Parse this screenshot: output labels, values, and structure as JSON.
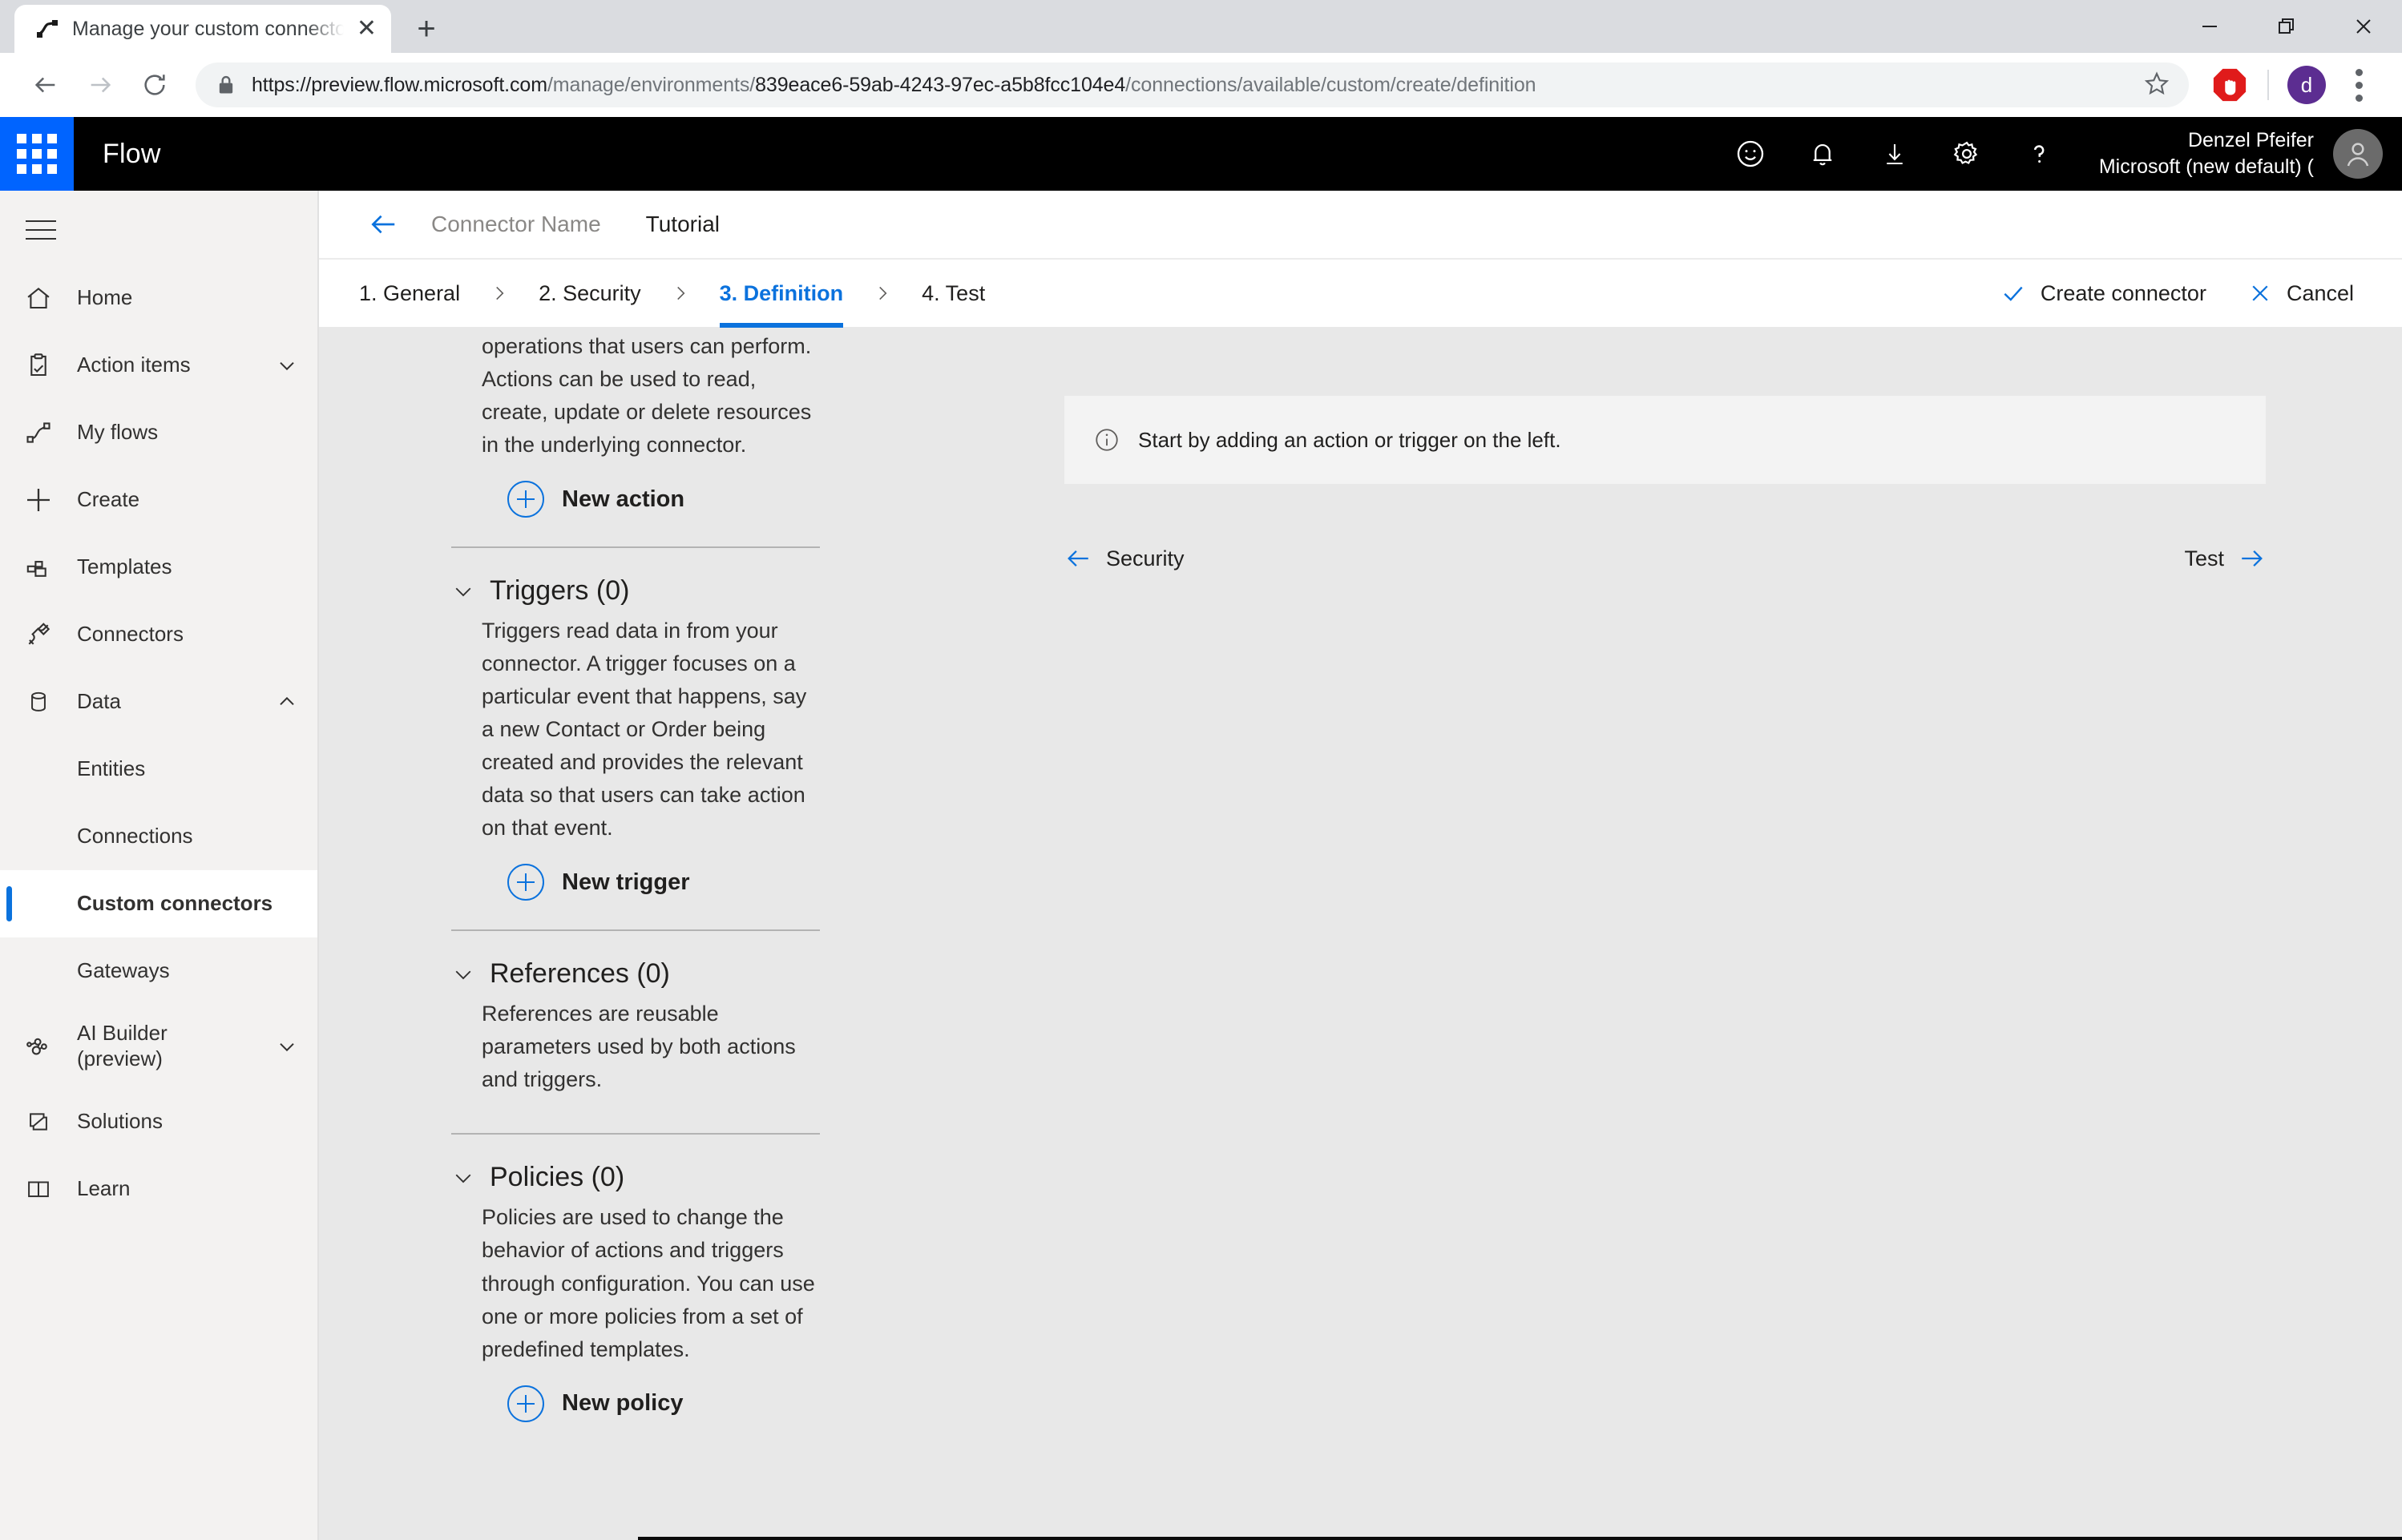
{
  "browser": {
    "tab": {
      "title": "Manage your custom connectors",
      "favicon": "flow-icon",
      "close": "✕"
    },
    "new_tab_label": "+",
    "window_controls": {
      "minimize": "minimize-icon",
      "maximize": "maximize-icon",
      "close": "close-icon"
    },
    "nav": {
      "back": "back-icon",
      "forward": "forward-icon",
      "reload": "reload-icon"
    },
    "url": {
      "scheme_host": "https://preview.flow.microsoft.com",
      "path_a": "/manage/environments/",
      "path_b": "839eace6-59ab-4243-97ec-a5b8fcc104e4",
      "path_c": "/connections/available/custom/create/definition",
      "full": "https://preview.flow.microsoft.com/manage/environments/839eace6-59ab-4243-97ec-a5b8fcc104e4/connections/available/custom/create/definition",
      "lock": "lock-icon"
    },
    "extensions": {
      "adblock": "adblock-icon"
    },
    "profile_initial": "d",
    "menu": "kebab-menu-icon"
  },
  "suitebar": {
    "waffle": "app-launcher-icon",
    "brand": "Flow",
    "icons": [
      "feedback-smiley-icon",
      "notification-bell-icon",
      "download-icon",
      "gear-icon",
      "help-icon"
    ],
    "user_name": "Denzel Pfeifer",
    "user_org": "Microsoft (new default) (",
    "avatar": "user-avatar-icon"
  },
  "sidebar": {
    "hamburger": "hamburger-menu-icon",
    "items": [
      {
        "label": "Home",
        "icon": "home-icon",
        "chevron": null,
        "level": "top",
        "selected": false
      },
      {
        "label": "Action items",
        "icon": "clipboard-check-icon",
        "chevron": "chevron-down",
        "level": "top",
        "selected": false
      },
      {
        "label": "My flows",
        "icon": "flow-nodes-icon",
        "chevron": null,
        "level": "top",
        "selected": false
      },
      {
        "label": "Create",
        "icon": "plus-icon",
        "chevron": null,
        "level": "top",
        "selected": false
      },
      {
        "label": "Templates",
        "icon": "templates-icon",
        "chevron": null,
        "level": "top",
        "selected": false
      },
      {
        "label": "Connectors",
        "icon": "plug-icon",
        "chevron": null,
        "level": "top",
        "selected": false
      },
      {
        "label": "Data",
        "icon": "database-icon",
        "chevron": "chevron-up",
        "level": "top",
        "selected": false
      },
      {
        "label": "Entities",
        "icon": null,
        "chevron": null,
        "level": "sub",
        "selected": false
      },
      {
        "label": "Connections",
        "icon": null,
        "chevron": null,
        "level": "sub",
        "selected": false
      },
      {
        "label": "Custom connectors",
        "icon": null,
        "chevron": null,
        "level": "sub",
        "selected": true
      },
      {
        "label": "Gateways",
        "icon": null,
        "chevron": null,
        "level": "sub",
        "selected": false
      },
      {
        "label": "AI Builder (preview)",
        "icon": "ai-builder-icon",
        "chevron": "chevron-down",
        "level": "top",
        "selected": false
      },
      {
        "label": "Solutions",
        "icon": "solutions-icon",
        "chevron": null,
        "level": "top",
        "selected": false
      },
      {
        "label": "Learn",
        "icon": "book-icon",
        "chevron": null,
        "level": "top",
        "selected": false
      }
    ]
  },
  "breadcrumb": {
    "back": "back-arrow-icon",
    "connector_name": "Connector Name",
    "current": "Tutorial"
  },
  "steps": {
    "separator": "›",
    "items": [
      {
        "label": "1. General",
        "active": false
      },
      {
        "label": "2. Security",
        "active": false
      },
      {
        "label": "3. Definition",
        "active": true
      },
      {
        "label": "4. Test",
        "active": false
      }
    ],
    "create_label": "Create connector",
    "create_icon": "checkmark-icon",
    "cancel_label": "Cancel",
    "cancel_icon": "x-icon"
  },
  "definition": {
    "actions_text": "operations that users can perform. Actions can be used to read, create, update or delete resources in the underlying connector.",
    "actions_button": {
      "label": "New action",
      "icon": "plus-circle-icon"
    },
    "sections": [
      {
        "title": "Triggers (0)",
        "chevron": "chevron-down-icon",
        "body": "Triggers read data in from your connector. A trigger focuses on a particular event that happens, say a new Contact or Order being created and provides the relevant data so that users can take action on that event.",
        "button": {
          "label": "New trigger",
          "icon": "plus-circle-icon"
        }
      },
      {
        "title": "References (0)",
        "chevron": "chevron-down-icon",
        "body": "References are reusable parameters used by both actions and triggers.",
        "button": null
      },
      {
        "title": "Policies (0)",
        "chevron": "chevron-down-icon",
        "body": "Policies are used to change the behavior of actions and triggers through configuration. You can use one or more policies from a set of predefined templates.",
        "button": {
          "label": "New policy",
          "icon": "plus-circle-icon"
        }
      }
    ]
  },
  "detail": {
    "info_icon": "info-icon",
    "info_message": "Start by adding an action or trigger on the left.",
    "prev_label": "Security",
    "prev_icon": "arrow-left-icon",
    "next_label": "Test",
    "next_icon": "arrow-right-icon"
  },
  "colors": {
    "accent_blue": "#0b72dd",
    "waffle_blue": "#0064ff",
    "suite_black": "#000000",
    "page_bg": "#e8e8e8",
    "nav_bg": "#f3f2f1",
    "info_bg": "#f3f3f3"
  }
}
